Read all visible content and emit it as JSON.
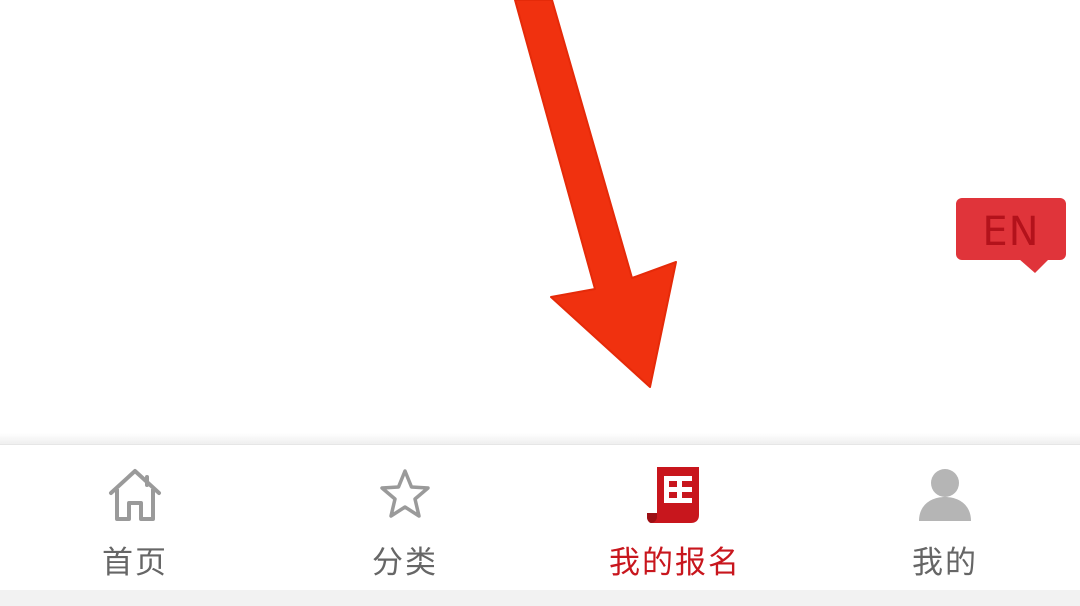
{
  "language_toggle": {
    "label": "EN"
  },
  "tabs": [
    {
      "label": "首页",
      "icon": "home-icon",
      "active": false
    },
    {
      "label": "分类",
      "icon": "star-icon",
      "active": false
    },
    {
      "label": "我的报名",
      "icon": "registration-document-icon",
      "active": true
    },
    {
      "label": "我的",
      "icon": "user-icon",
      "active": false
    }
  ],
  "colors": {
    "accent": "#c8161d",
    "inactive": "#999999",
    "arrow": "#f0310f",
    "badge": "#e0343a"
  }
}
